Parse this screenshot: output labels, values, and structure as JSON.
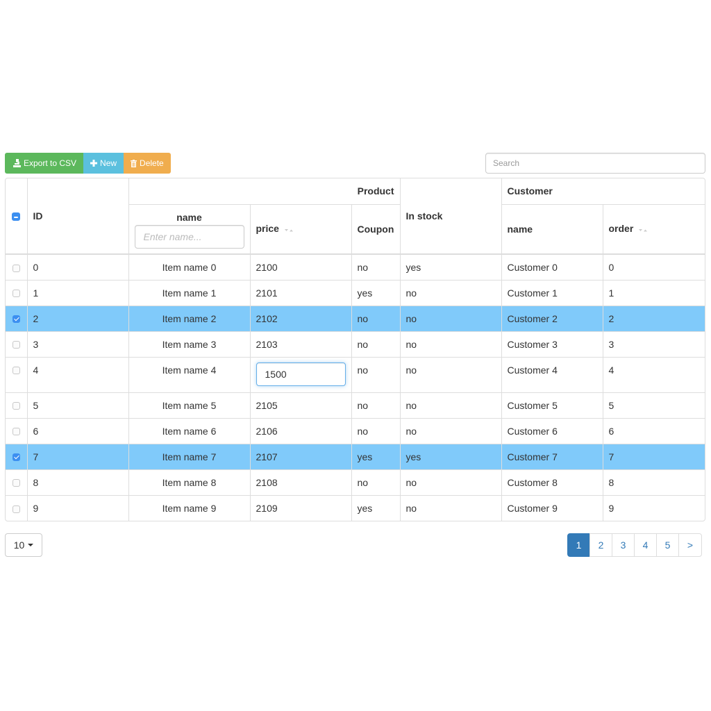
{
  "toolbar": {
    "export_label": "Export to CSV",
    "new_label": "New",
    "delete_label": "Delete",
    "colors": {
      "export": "#5cb85c",
      "new": "#5bc0de",
      "delete": "#f0ad4e"
    }
  },
  "search": {
    "placeholder": "Search",
    "value": ""
  },
  "table": {
    "headers": {
      "select_all_state": "indeterminate",
      "id": "ID",
      "product_group": "Product",
      "name": "name",
      "name_filter_placeholder": "Enter name...",
      "price": "price",
      "coupon": "Coupon",
      "in_stock": "In stock",
      "customer_group": "Customer",
      "customer_name": "name",
      "order": "order"
    },
    "rows": [
      {
        "selected": false,
        "id": "0",
        "name": "Item name 0",
        "price": "2100",
        "coupon": "no",
        "in_stock": "yes",
        "customer": "Customer 0",
        "order": "0"
      },
      {
        "selected": false,
        "id": "1",
        "name": "Item name 1",
        "price": "2101",
        "coupon": "yes",
        "in_stock": "no",
        "customer": "Customer 1",
        "order": "1"
      },
      {
        "selected": true,
        "id": "2",
        "name": "Item name 2",
        "price": "2102",
        "coupon": "no",
        "in_stock": "no",
        "customer": "Customer 2",
        "order": "2"
      },
      {
        "selected": false,
        "id": "3",
        "name": "Item name 3",
        "price": "2103",
        "coupon": "no",
        "in_stock": "no",
        "customer": "Customer 3",
        "order": "3"
      },
      {
        "selected": false,
        "id": "4",
        "name": "Item name 4",
        "price": "1500",
        "price_editing": true,
        "coupon": "no",
        "in_stock": "no",
        "customer": "Customer 4",
        "order": "4"
      },
      {
        "selected": false,
        "id": "5",
        "name": "Item name 5",
        "price": "2105",
        "coupon": "no",
        "in_stock": "no",
        "customer": "Customer 5",
        "order": "5"
      },
      {
        "selected": false,
        "id": "6",
        "name": "Item name 6",
        "price": "2106",
        "coupon": "no",
        "in_stock": "no",
        "customer": "Customer 6",
        "order": "6"
      },
      {
        "selected": true,
        "id": "7",
        "name": "Item name 7",
        "price": "2107",
        "coupon": "yes",
        "in_stock": "yes",
        "customer": "Customer 7",
        "order": "7"
      },
      {
        "selected": false,
        "id": "8",
        "name": "Item name 8",
        "price": "2108",
        "coupon": "no",
        "in_stock": "no",
        "customer": "Customer 8",
        "order": "8"
      },
      {
        "selected": false,
        "id": "9",
        "name": "Item name 9",
        "price": "2109",
        "coupon": "yes",
        "in_stock": "no",
        "customer": "Customer 9",
        "order": "9"
      }
    ],
    "selected_row_color": "#80cafa"
  },
  "footer": {
    "page_size": "10",
    "pages": [
      "1",
      "2",
      "3",
      "4",
      "5"
    ],
    "current_page": "1",
    "next_label": ">"
  }
}
